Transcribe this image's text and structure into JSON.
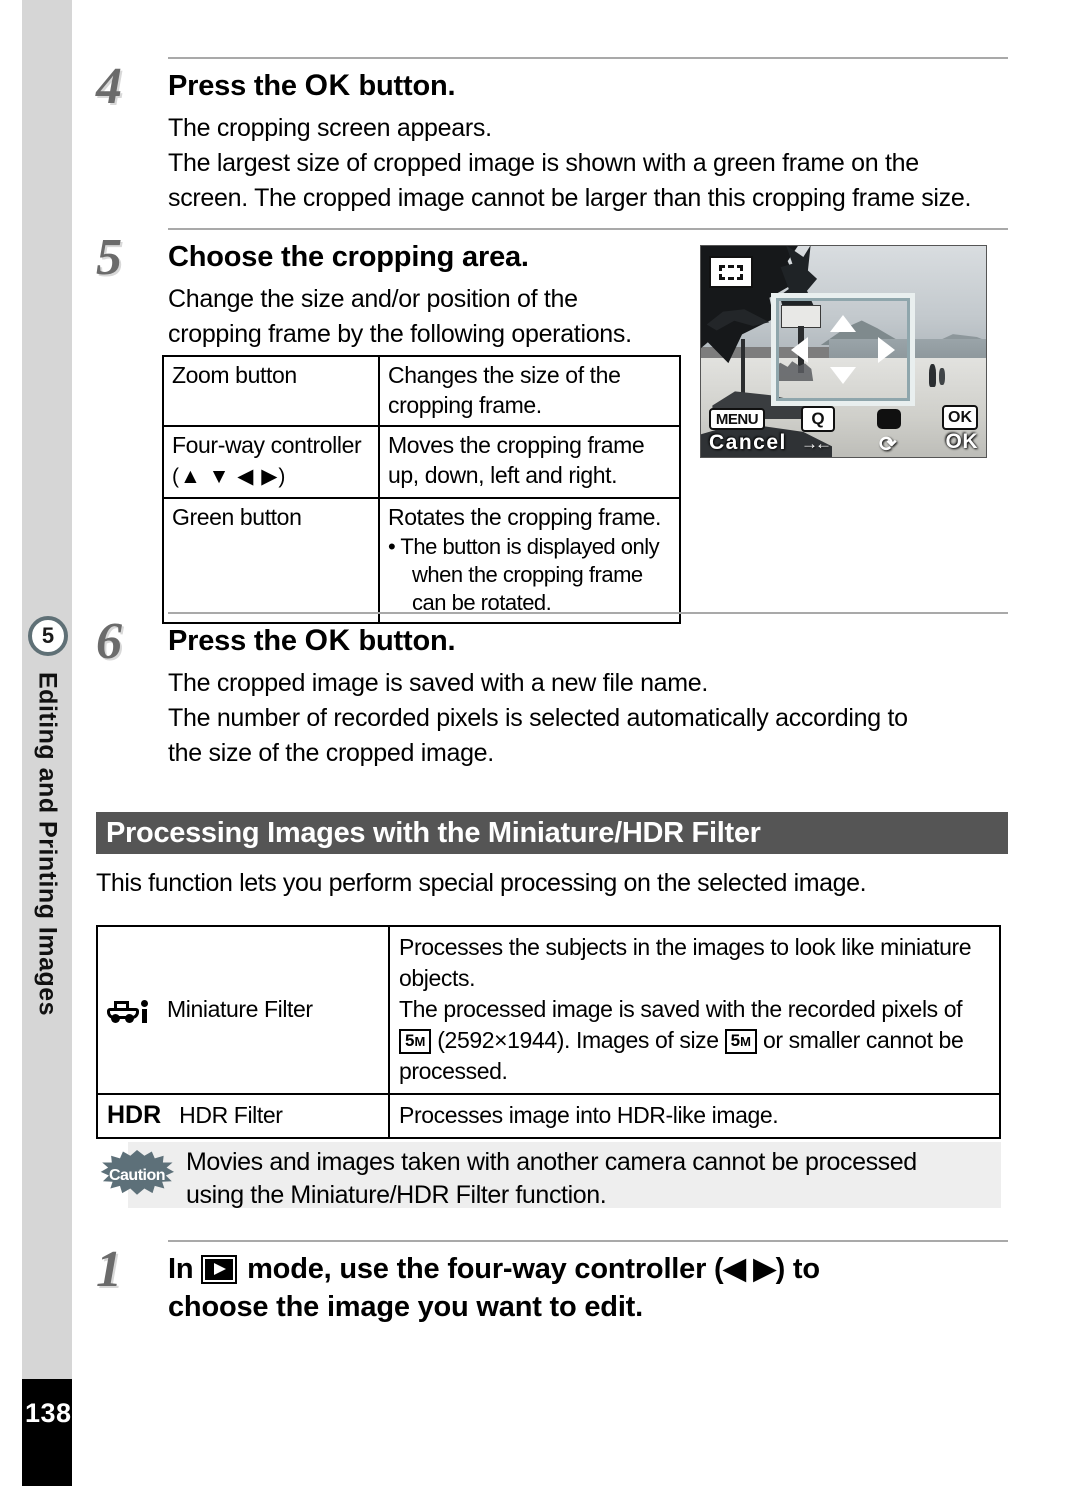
{
  "sidebar": {
    "chapter_number": "5",
    "chapter_title": "Editing and Printing Images",
    "page_number": "138"
  },
  "steps": {
    "step4": {
      "number": "4",
      "heading_before": "Press the ",
      "heading_ok": "OK",
      "heading_after": " button.",
      "line1": "The cropping screen appears.",
      "line2": "The largest size of cropped image is shown with a green frame on the",
      "line3": "screen. The cropped image cannot be larger than this cropping frame size."
    },
    "step5": {
      "number": "5",
      "heading": "Choose the cropping area.",
      "line1": "Change the size and/or position of the",
      "line2": "cropping frame by the following operations."
    },
    "step6": {
      "number": "6",
      "heading_before": "Press the ",
      "heading_ok": "OK",
      "heading_after": " button.",
      "line1": "The cropped image is saved with a new file name.",
      "line2": "The number of recorded pixels is selected automatically according to",
      "line3": "the size of the cropped image."
    },
    "step1": {
      "number": "1",
      "heading_part1": "In ",
      "heading_icon": "playback-mode-icon",
      "heading_part2": " mode, use the four-way controller (",
      "heading_arrows": "◀ ▶",
      "heading_part3": ") to",
      "heading_line2": "choose the image you want to edit."
    }
  },
  "ops_table": {
    "rows": [
      {
        "control": "Zoom button",
        "control_arrows": "",
        "description": "Changes the size of the cropping frame.",
        "bullet": ""
      },
      {
        "control": "Four-way controller",
        "control_arrows": "(▲ ▼ ◀ ▶)",
        "description": "Moves the cropping frame up, down, left and right.",
        "bullet": ""
      },
      {
        "control": "Green button",
        "control_arrows": "",
        "description": "Rotates the cropping frame.",
        "bullet": "•  The button is displayed only when the cropping frame can be rotated."
      }
    ]
  },
  "camera_screen": {
    "crop_icon_name": "crop-frame-icon",
    "menu_key": "MENU",
    "zoom_key": "Q",
    "ok_key": "OK",
    "cancel_label": "Cancel",
    "ok_label": "OK",
    "move_glyph": "→←",
    "rotate_glyph": "⟳",
    "green_key_name": "green-button"
  },
  "section": {
    "title": "Processing Images with the Miniature/HDR Filter",
    "intro": "This function lets you perform special processing on the selected image."
  },
  "filter_table": {
    "rows": [
      {
        "icon": "miniature-car-icon",
        "name": "Miniature Filter",
        "desc_line1": "Processes the subjects in the images to look like miniature",
        "desc_line2": "objects.",
        "desc_line3": "The processed image is saved with the recorded pixels of",
        "desc_line4_pre": " (2592×1944). Images of size ",
        "desc_line4_post": " or smaller cannot be",
        "desc_line5": "processed.",
        "badge": "5",
        "badge_sub": "M"
      },
      {
        "icon": "hdr-icon",
        "name": "HDR Filter",
        "label": "HDR",
        "description": "Processes image into HDR-like image."
      }
    ]
  },
  "caution": {
    "icon_label": "Caution",
    "line1": "Movies and images taken with another camera cannot be processed",
    "line2": "using the Miniature/HDR Filter function."
  },
  "colors": {
    "sidebar_bg": "#d6d6d6",
    "section_bar_bg": "#555555",
    "caution_bg": "#eeeeee",
    "caution_icon": "#5d7079",
    "crop_frame": "#8fa6ac"
  }
}
